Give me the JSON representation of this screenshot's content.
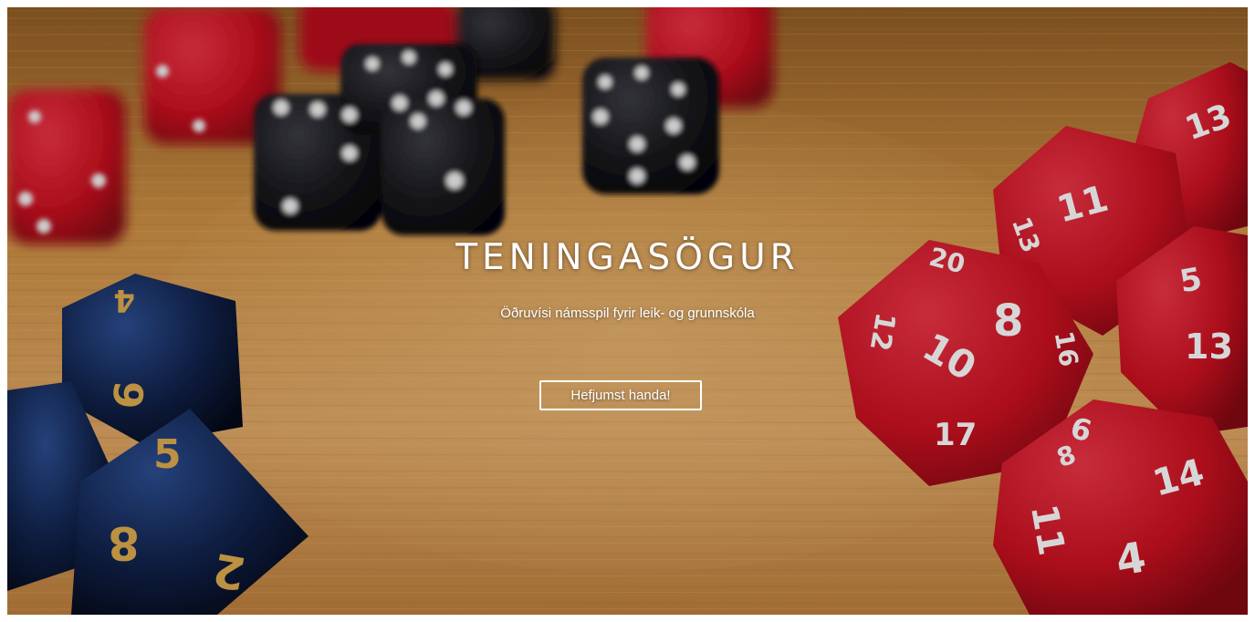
{
  "hero": {
    "title": "TENINGASÖGUR",
    "subtitle": "Öðruvísi námsspil fyrir leik- og grunnskóla",
    "cta_label": "Hefjumst handa!"
  },
  "background": {
    "description_icon": "dice-photo",
    "colors": {
      "table_wood": "#c98f44",
      "red_die": "#c8101e",
      "black_die": "#121217",
      "blue_die": "#0f1f45",
      "die_pip": "#f5f5f5",
      "gold_numeral": "#d6a54a"
    }
  }
}
